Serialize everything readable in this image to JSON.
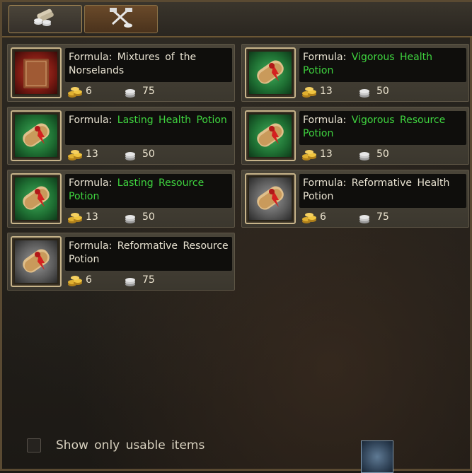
{
  "tabs": [
    {
      "icon": "scrolls-coins-icon",
      "active": true
    },
    {
      "icon": "crossed-hammers-icon",
      "active": false
    }
  ],
  "items": [
    {
      "prefix": "Formula: ",
      "name": "Mixtures of the Norselands",
      "name_color": "#e9e3d2",
      "icon": "red-book-icon",
      "bg": "red",
      "gold": "6",
      "silver": "75"
    },
    {
      "prefix": "Formula: ",
      "name": "Vigorous Health Potion",
      "name_color": "#3fd43f",
      "icon": "scroll-icon",
      "bg": "green",
      "gold": "13",
      "silver": "50"
    },
    {
      "prefix": "Formula: ",
      "name": "Lasting Health Potion",
      "name_color": "#3fd43f",
      "icon": "scroll-icon",
      "bg": "green",
      "gold": "13",
      "silver": "50"
    },
    {
      "prefix": "Formula: ",
      "name": "Vigorous Resource Potion",
      "name_color": "#3fd43f",
      "icon": "scroll-icon",
      "bg": "green",
      "gold": "13",
      "silver": "50"
    },
    {
      "prefix": "Formula: ",
      "name": "Lasting Resource Potion",
      "name_color": "#3fd43f",
      "icon": "scroll-icon",
      "bg": "green",
      "gold": "13",
      "silver": "50"
    },
    {
      "prefix": "Formula: ",
      "name": "Reformative Health Potion",
      "name_color": "#e9e3d2",
      "icon": "scroll-icon",
      "bg": "gray",
      "gold": "6",
      "silver": "75"
    },
    {
      "prefix": "Formula: ",
      "name": "Reformative Resource Potion",
      "name_color": "#e9e3d2",
      "icon": "scroll-icon",
      "bg": "gray",
      "gold": "6",
      "silver": "75"
    }
  ],
  "footer": {
    "checkbox_label": "Show only usable items",
    "checked": false
  },
  "colors": {
    "green_name": "#3fd43f",
    "white_name": "#e9e3d2",
    "gold": "#e0b030",
    "silver": "#c8c8c8"
  }
}
